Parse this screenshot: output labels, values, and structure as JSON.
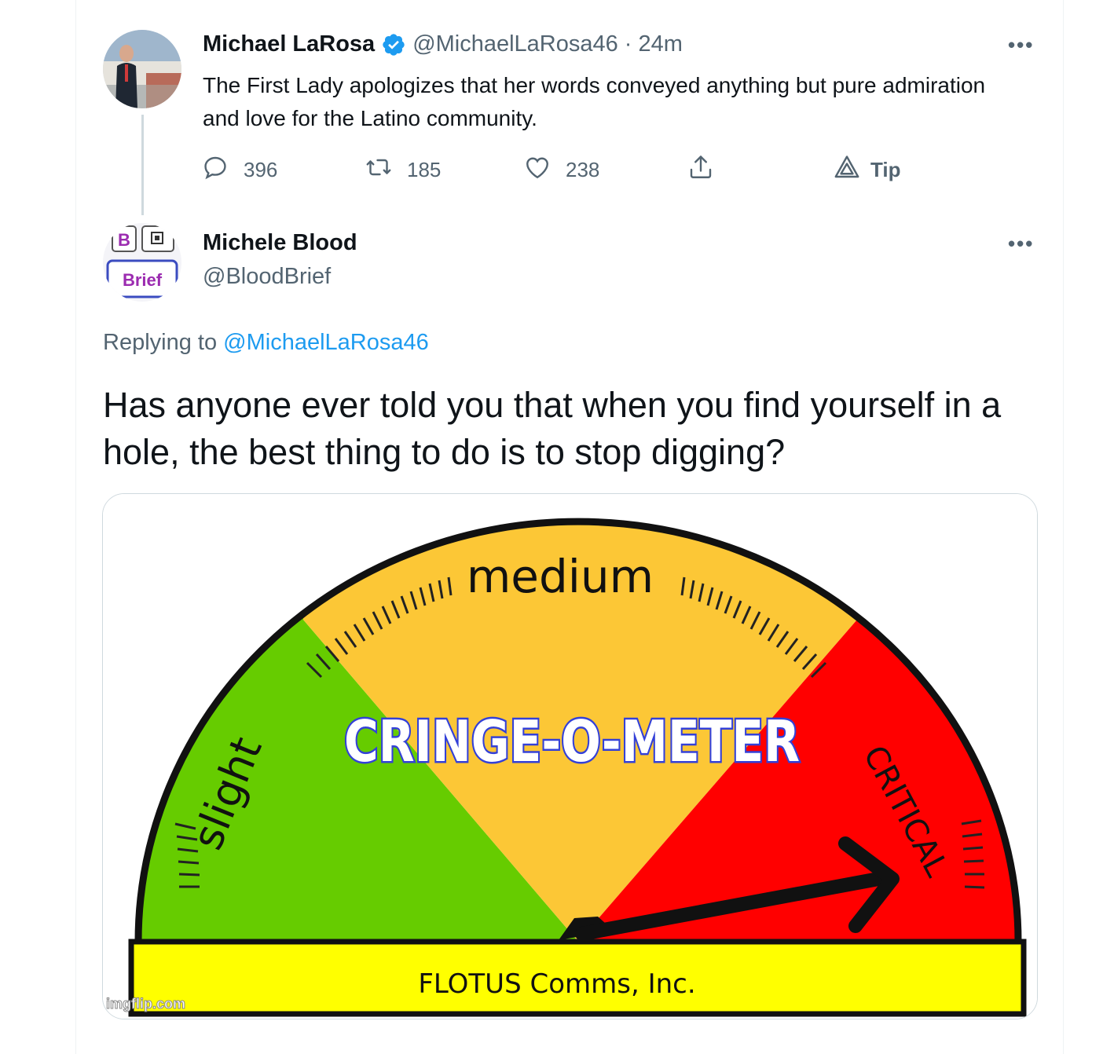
{
  "parent_tweet": {
    "display_name": "Michael LaRosa",
    "handle": "@MichaelLaRosa46",
    "separator": "·",
    "time": "24m",
    "text": "The First Lady apologizes that her words conveyed anything but pure admiration and love for the Latino community.",
    "more_label": "•••",
    "actions": {
      "replies": "396",
      "retweets": "185",
      "likes": "238",
      "tip_label": "Tip"
    },
    "icons": [
      "verified-badge-icon",
      "reply-icon",
      "retweet-icon",
      "like-icon",
      "share-icon",
      "tip-icon"
    ]
  },
  "reply_tweet": {
    "display_name": "Michele Blood",
    "handle": "@BloodBrief",
    "more_label": "•••",
    "avatar_text": {
      "top": "B",
      "bottom": "Brief"
    },
    "replying_prefix": "Replying to",
    "replying_to": "@MichaelLaRosa46",
    "text": "Has anyone ever told you that when you find yourself in a hole, the best thing to do is to stop digging?"
  },
  "meme": {
    "label_slight": "slight",
    "label_medium": "medium",
    "label_critical": "CRITICAL",
    "title": "CRINGE-O-METER",
    "footer": "FLOTUS Comms, Inc.",
    "watermark": "imgflip.com",
    "colors": {
      "green": "#66cc00",
      "yellow": "#fcc736",
      "red": "#ff0000",
      "band": "#ffff00",
      "title_fill": "#ffffff",
      "title_stroke": "#3340d8"
    }
  },
  "colors": {
    "link": "#1d9bf0",
    "secondary_text": "#536471",
    "verified": "#1d9bf0"
  }
}
